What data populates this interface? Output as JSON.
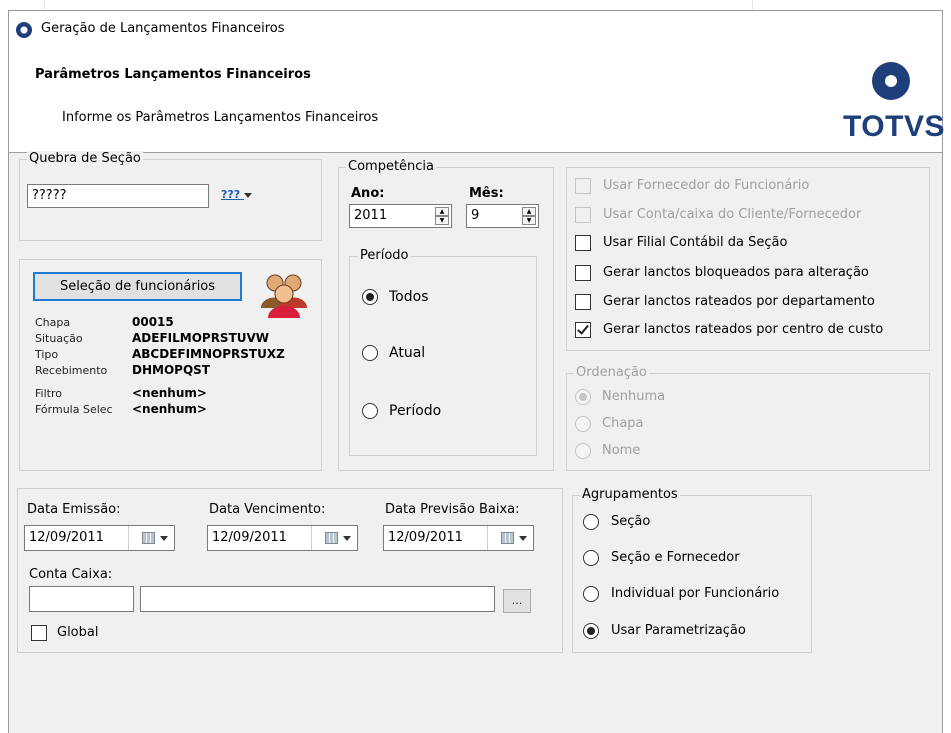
{
  "window": {
    "title": "Geração de Lançamentos Financeiros"
  },
  "header": {
    "title": "Parâmetros Lançamentos Financeiros",
    "subtitle": "Informe os Parâmetros Lançamentos Financeiros",
    "logo_text": "TOTVS"
  },
  "quebra": {
    "legend": "Quebra de Seção",
    "value": "?????",
    "picker_label": "???"
  },
  "funcionarios": {
    "button_label": "Seleção de funcionários",
    "rows": [
      {
        "label": "Chapa",
        "value": "00015"
      },
      {
        "label": "Situação",
        "value": "ADEFILMOPRSTUVW"
      },
      {
        "label": "Tipo",
        "value": "ABCDEFIMNOPRSTUXZ"
      },
      {
        "label": "Recebimento",
        "value": "DHMOPQST"
      },
      {
        "label": "Filtro",
        "value": "<nenhum>"
      },
      {
        "label": "Fórmula Selec",
        "value": "<nenhum>"
      }
    ]
  },
  "competencia": {
    "legend": "Competência",
    "ano_label": "Ano:",
    "ano_value": "2011",
    "mes_label": "Mês:",
    "mes_value": "9"
  },
  "periodo": {
    "legend": "Período",
    "options": [
      {
        "label": "Todos",
        "selected": true
      },
      {
        "label": "Atual",
        "selected": false
      },
      {
        "label": "Período",
        "selected": false
      }
    ]
  },
  "options": [
    {
      "label": "Usar Fornecedor do Funcionário",
      "checked": false,
      "enabled": false
    },
    {
      "label": "Usar Conta/caixa do Cliente/Fornecedor",
      "checked": false,
      "enabled": false
    },
    {
      "label": "Usar Filial Contábil da Seção",
      "checked": false,
      "enabled": true
    },
    {
      "label": "Gerar lanctos bloqueados para alteração",
      "checked": false,
      "enabled": true
    },
    {
      "label": "Gerar lanctos rateados por departamento",
      "checked": false,
      "enabled": true
    },
    {
      "label": "Gerar lanctos rateados por centro de custo",
      "checked": true,
      "enabled": true
    }
  ],
  "ordenacao": {
    "legend": "Ordenação",
    "options": [
      {
        "label": "Nenhuma",
        "selected": true
      },
      {
        "label": "Chapa",
        "selected": false
      },
      {
        "label": "Nome",
        "selected": false
      }
    ]
  },
  "datas": {
    "emissao_label": "Data Emissão:",
    "emissao_value": "12/09/2011",
    "vencimento_label": "Data Vencimento:",
    "vencimento_value": "12/09/2011",
    "previsao_label": "Data Previsão Baixa:",
    "previsao_value": "12/09/2011",
    "conta_label": "Conta Caixa:",
    "conta_code": "",
    "conta_desc": "",
    "browse_label": "...",
    "global_label": "Global"
  },
  "agrupamentos": {
    "legend": "Agrupamentos",
    "options": [
      {
        "label": "Seção",
        "selected": false
      },
      {
        "label": "Seção e Fornecedor",
        "selected": false
      },
      {
        "label": "Individual por Funcionário",
        "selected": false
      },
      {
        "label": "Usar Parametrização",
        "selected": true
      }
    ]
  },
  "colors": {
    "brand": "#1f3f7a",
    "focus": "#1e7bd4",
    "disabled_text": "#a0a0a0"
  }
}
